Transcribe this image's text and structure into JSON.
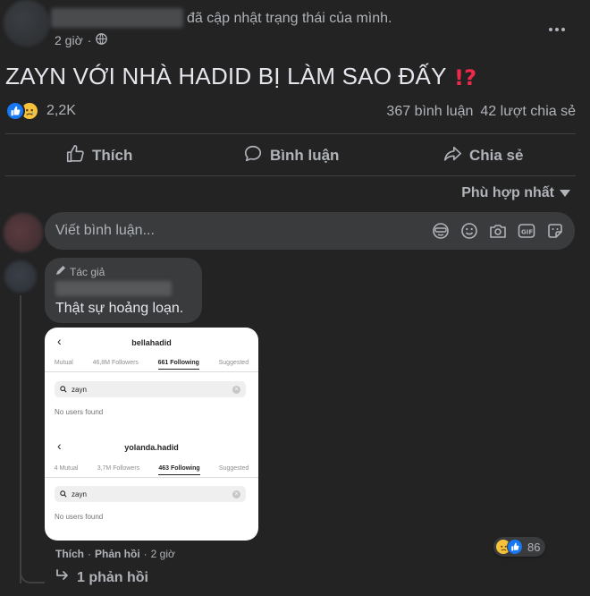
{
  "post": {
    "status_text": "đã cập nhật trạng thái của mình.",
    "time": "2 giờ",
    "title": "ZAYN VỚI NHÀ HADID BỊ LÀM SAO ĐẤY",
    "title_emoji": "⁉️",
    "reaction_count": "2,2K",
    "comment_count": "367 bình luận",
    "share_count": "42 lượt chia sẻ",
    "reactions": [
      "like-icon",
      "sad-icon"
    ]
  },
  "actions": {
    "like": "Thích",
    "comment": "Bình luận",
    "share": "Chia sẻ"
  },
  "sort": {
    "label": "Phù hợp nhất"
  },
  "composer": {
    "placeholder": "Viết bình luận..."
  },
  "comment": {
    "author_badge": "Tác giả",
    "text": "Thật sự hoảng loạn.",
    "like": "Thích",
    "reply": "Phản hồi",
    "time": "2 giờ",
    "reaction_count": "86",
    "replies_label": "1 phản hồi",
    "screenshot": {
      "panel1": {
        "username": "bellahadid",
        "tabs": [
          "Mutual",
          "46,8M Followers",
          "661 Following",
          "Suggested"
        ],
        "active_tab": "661 Following",
        "search_value": "zayn",
        "result": "No users found"
      },
      "panel2": {
        "username": "yolanda.hadid",
        "tabs": [
          "4 Mutual",
          "3,7M Followers",
          "463 Following",
          "Suggested"
        ],
        "active_tab": "463 Following",
        "search_value": "zayn",
        "result": "No users found"
      }
    }
  },
  "colors": {
    "background": "#232324",
    "surface": "#3a3b3c",
    "text_primary": "#e4e6eb",
    "text_secondary": "#b0b3b8",
    "like_blue": "#1877f2",
    "sad_yellow": "#f5c33b"
  }
}
